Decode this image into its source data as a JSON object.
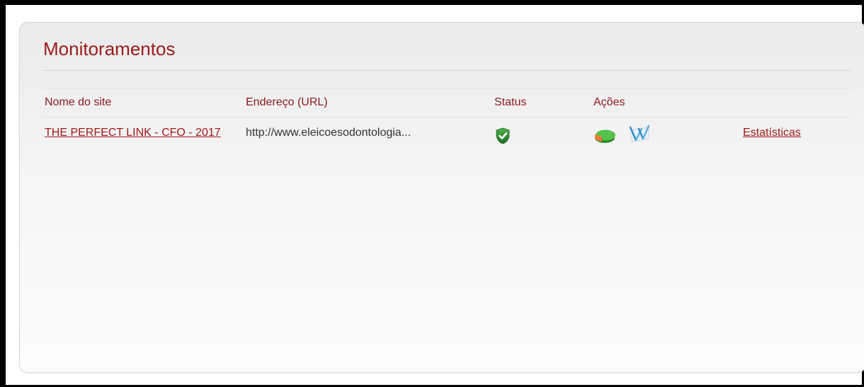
{
  "panel": {
    "title": "Monitoramentos"
  },
  "table": {
    "columns": [
      "Nome do site",
      "Endereço (URL)",
      "Status",
      "Ações"
    ],
    "rows": [
      {
        "site_name": "THE PERFECT LINK - CFO - 2017",
        "url": "http://www.eleicoesodontologia...",
        "status_icon": "shield-check-icon",
        "actions": [
          "pie-chart-icon",
          "stats-chart-icon"
        ],
        "stats_link": "Estatísticas"
      }
    ]
  },
  "colors": {
    "accent": "#9b1b1b",
    "status_ok": "#2e8b2e"
  }
}
